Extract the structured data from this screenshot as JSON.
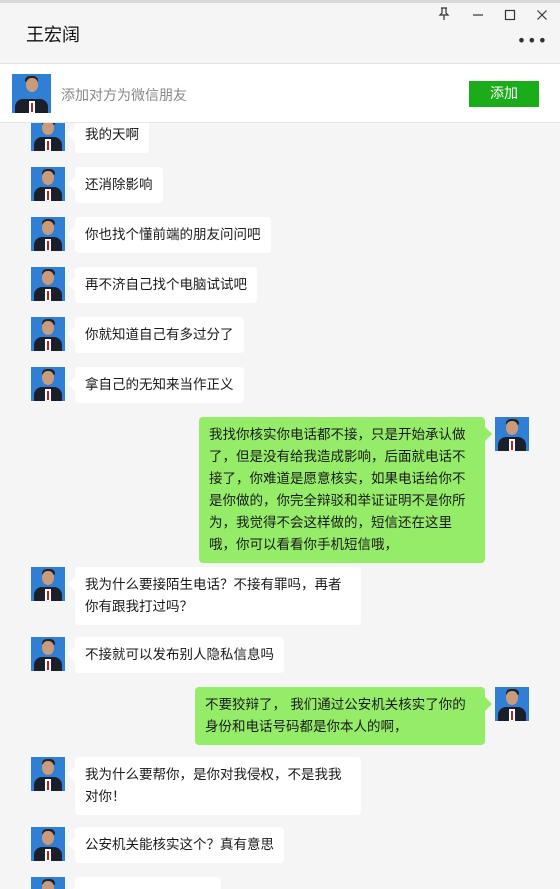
{
  "window": {
    "title": "王宏阔",
    "pin_icon": "pin-icon",
    "minimize_icon": "minimize-icon",
    "maximize_icon": "maximize-icon",
    "close_icon": "close-icon",
    "more_icon": "more-options-icon"
  },
  "add_friend_bar": {
    "text": "添加对方为微信朋友",
    "button_label": "添加"
  },
  "colors": {
    "incoming_bubble": "#ffffff",
    "outgoing_bubble": "#95ec69",
    "add_button": "#1aad19"
  },
  "messages": [
    {
      "side": "left",
      "text": "我的天啊"
    },
    {
      "side": "left",
      "text": "还消除影响"
    },
    {
      "side": "left",
      "text": "你也找个懂前端的朋友问问吧"
    },
    {
      "side": "left",
      "text": "再不济自己找个电脑试试吧"
    },
    {
      "side": "left",
      "text": "你就知道自己有多过分了"
    },
    {
      "side": "left",
      "text": "拿自己的无知来当作正义"
    },
    {
      "side": "right",
      "text": "我找你核实你电话都不接，只是开始承认做了，但是没有给我造成影响，后面就电话不接了，你难道是愿意核实，如果电话给你不是你做的，你完全辩驳和举证证明不是你所为，我觉得不会这样做的，短信还在这里哦，你可以看看你手机短信哦，"
    },
    {
      "side": "left",
      "text": "我为什么要接陌生电话？不接有罪吗，再者你有跟我打过吗？"
    },
    {
      "side": "left",
      "text": "不接就可以发布别人隐私信息吗"
    },
    {
      "side": "right",
      "text": "不要狡辩了， 我们通过公安机关核实了你的身份和电话号码都是你本人的啊，"
    },
    {
      "side": "left",
      "text": "我为什么要帮你，是你对我侵权，不是我我对你！"
    },
    {
      "side": "left",
      "text": "公安机关能核实这个？真有意思"
    },
    {
      "side": "left",
      "text": ""
    }
  ]
}
